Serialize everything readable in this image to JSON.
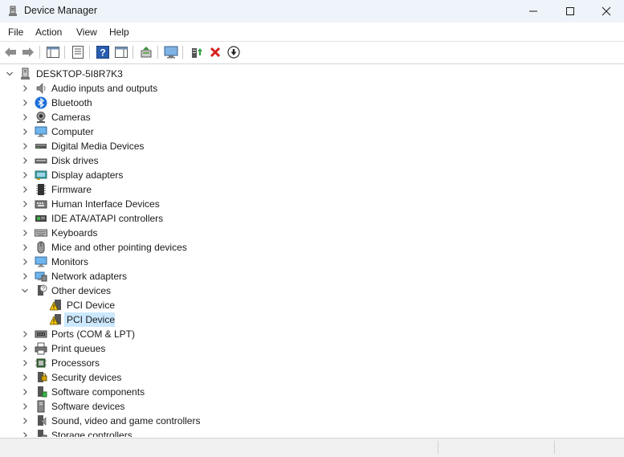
{
  "window": {
    "title": "Device Manager"
  },
  "menu": [
    "File",
    "Action",
    "View",
    "Help"
  ],
  "toolbar": {
    "buttons": [
      "back",
      "forward",
      "show-hide-console-tree",
      "properties",
      "help",
      "show-action-pane",
      "update-driver",
      "scan-for-hardware-changes",
      "enable-device",
      "uninstall-device",
      "disable-device"
    ]
  },
  "tree": {
    "root": "DESKTOP-5I8R7K3",
    "categories": [
      {
        "label": "Audio inputs and outputs",
        "icon": "speaker-icon"
      },
      {
        "label": "Bluetooth",
        "icon": "bluetooth-icon"
      },
      {
        "label": "Cameras",
        "icon": "camera-icon"
      },
      {
        "label": "Computer",
        "icon": "computer-icon"
      },
      {
        "label": "Digital Media Devices",
        "icon": "media-device-icon"
      },
      {
        "label": "Disk drives",
        "icon": "disk-drive-icon"
      },
      {
        "label": "Display adapters",
        "icon": "display-adapter-icon"
      },
      {
        "label": "Firmware",
        "icon": "firmware-chip-icon"
      },
      {
        "label": "Human Interface Devices",
        "icon": "hid-icon"
      },
      {
        "label": "IDE ATA/ATAPI controllers",
        "icon": "ide-controller-icon"
      },
      {
        "label": "Keyboards",
        "icon": "keyboard-icon"
      },
      {
        "label": "Mice and other pointing devices",
        "icon": "mouse-icon"
      },
      {
        "label": "Monitors",
        "icon": "monitor-icon"
      },
      {
        "label": "Network adapters",
        "icon": "network-adapter-icon"
      },
      {
        "label": "Other devices",
        "icon": "unknown-device-icon",
        "expanded": true,
        "children": [
          {
            "label": "PCI Device",
            "icon": "warning-device-icon"
          },
          {
            "label": "PCI Device",
            "icon": "warning-device-icon",
            "selected": true
          }
        ]
      },
      {
        "label": "Ports (COM & LPT)",
        "icon": "port-icon"
      },
      {
        "label": "Print queues",
        "icon": "printer-icon"
      },
      {
        "label": "Processors",
        "icon": "processor-icon"
      },
      {
        "label": "Security devices",
        "icon": "security-device-icon"
      },
      {
        "label": "Software components",
        "icon": "software-component-icon"
      },
      {
        "label": "Software devices",
        "icon": "software-device-icon"
      },
      {
        "label": "Sound, video and game controllers",
        "icon": "sound-controller-icon"
      },
      {
        "label": "Storage controllers",
        "icon": "storage-controller-icon"
      }
    ]
  },
  "colors": {
    "titlebar": "#eef4f9",
    "selection": "#cce8ff",
    "statusbar": "#f0f0f0",
    "error_red": "#d61f1f",
    "warning_yellow": "#f5c400"
  }
}
